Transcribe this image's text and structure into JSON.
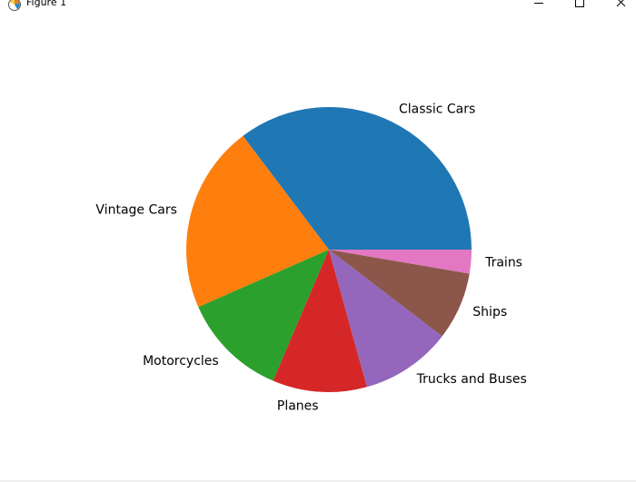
{
  "window": {
    "title": "Figure 1",
    "icon": "matplotlib-figure-icon",
    "controls": [
      "minimize-icon",
      "maximize-icon",
      "close-icon"
    ]
  },
  "chart_data": {
    "type": "pie",
    "labels": [
      "Classic Cars",
      "Vintage Cars",
      "Motorcycles",
      "Planes",
      "Trucks and Buses",
      "Ships",
      "Trains"
    ],
    "values": [
      35.3,
      21.3,
      12.0,
      10.7,
      10.3,
      7.7,
      2.7
    ],
    "colors": [
      "#1f77b4",
      "#ff7f0e",
      "#2ca02c",
      "#d62728",
      "#9467bd",
      "#8c564b",
      "#e377c2"
    ],
    "start_angle": 0,
    "direction": "counterclockwise",
    "title": ""
  }
}
